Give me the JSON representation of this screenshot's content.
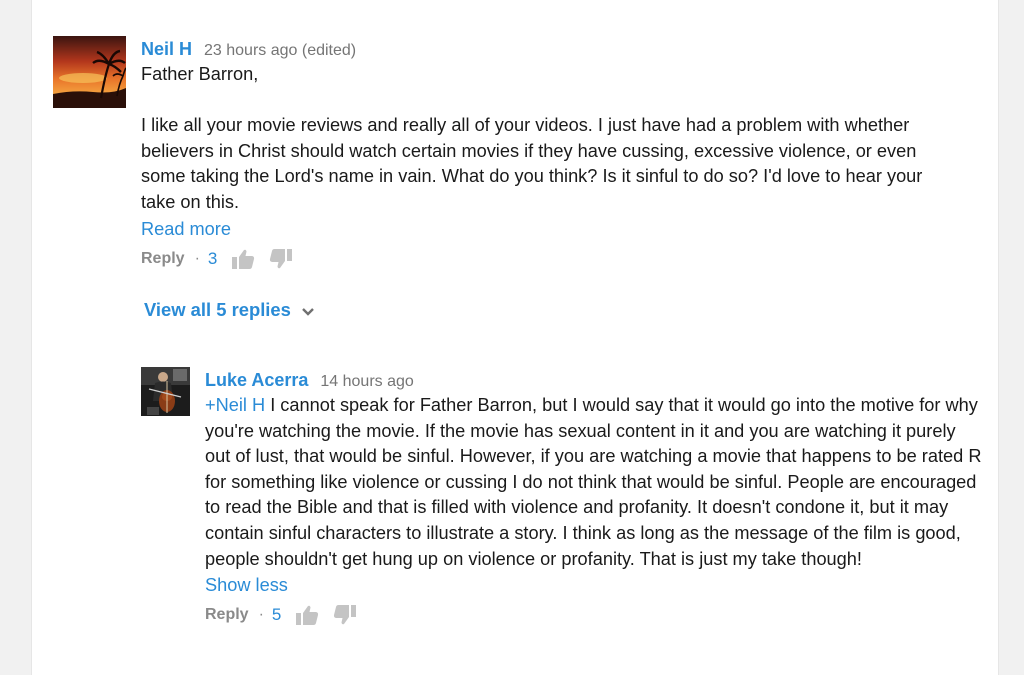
{
  "thread": {
    "comment": {
      "author": "Neil H",
      "time": "23 hours ago (edited)",
      "greeting": "Father Barron,",
      "text": "I like all your movie reviews and really all of your videos. I just have had a problem with whether believers in Christ should watch certain movies if they have cussing, excessive violence, or even some taking the Lord's name in vain. What do you think? Is it sinful to do so? I'd love to hear your take on this.",
      "read_more_label": "Read more",
      "reply_label": "Reply",
      "separator": "·",
      "likes": "3",
      "avatar_icon": "sunset-palm-avatar"
    },
    "view_replies_label": "View all 5 replies",
    "reply": {
      "author": "Luke Acerra",
      "time": "14 hours ago",
      "mention": "+Neil H",
      "text": " I cannot speak for Father Barron, but I would say that it would go into the motive for why you're watching the movie. If the movie has sexual content in it and you are watching it purely out of lust, that would be sinful. However, if you are watching a movie that happens to be rated R for something like violence or cussing I do not think that would be sinful. People are encouraged to read the Bible and that is filled with violence and profanity. It doesn't condone it, but it may contain sinful characters to illustrate a story. I think as long as the message of the film is good, people shouldn't get hung up on violence or profanity. That is just my take though!",
      "show_less_label": "Show less",
      "reply_label": "Reply",
      "separator": "·",
      "likes": "5",
      "avatar_icon": "cellist-avatar"
    }
  },
  "colors": {
    "link": "#2a8bd6",
    "text": "#1a1a1a",
    "meta": "#757575",
    "action": "#8a8a8a",
    "icon": "#c4c4c4"
  }
}
